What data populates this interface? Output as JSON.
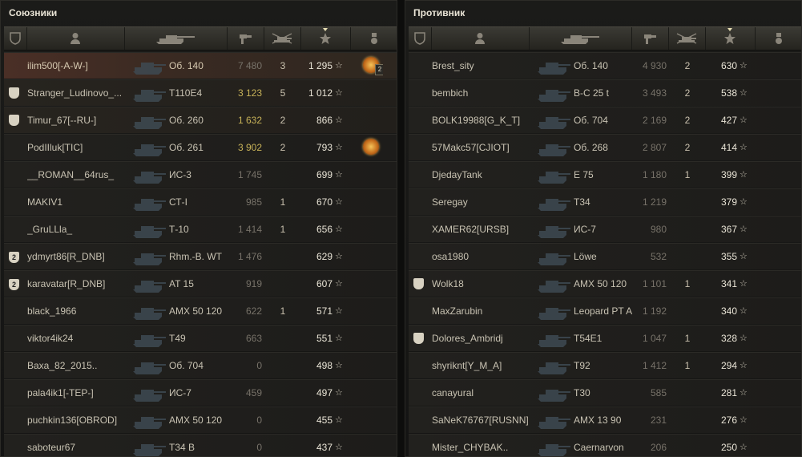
{
  "allies": {
    "title": "Союзники",
    "rows": [
      {
        "name": "ilim500[-A-W-]",
        "tank": "Об. 140",
        "damage": "7 480",
        "frags": "3",
        "xp": "1 295",
        "badge": "",
        "medal": true,
        "medal_count": "2",
        "highlight": "player"
      },
      {
        "name": "Stranger_Ludinovo_...",
        "tank": "T110E4",
        "damage": "3 123",
        "frags": "5",
        "xp": "1 012",
        "badge": "shield",
        "medal": false,
        "medal_count": "",
        "highlight": "platoon"
      },
      {
        "name": "Timur_67[--RU-]",
        "tank": "Об. 260",
        "damage": "1 632",
        "frags": "2",
        "xp": "866",
        "badge": "shield",
        "medal": false,
        "medal_count": "",
        "highlight": "platoon"
      },
      {
        "name": "PodIIluk[TIC]",
        "tank": "Об. 261",
        "damage": "3 902",
        "frags": "2",
        "xp": "793",
        "badge": "",
        "medal": true,
        "medal_count": "",
        "highlight": ""
      },
      {
        "name": "__ROMAN__64rus_",
        "tank": "ИС-3",
        "damage": "1 745",
        "frags": "",
        "xp": "699",
        "badge": "",
        "medal": false,
        "medal_count": "",
        "highlight": ""
      },
      {
        "name": "MAKIV1",
        "tank": "СТ-I",
        "damage": "985",
        "frags": "1",
        "xp": "670",
        "badge": "",
        "medal": false,
        "medal_count": "",
        "highlight": ""
      },
      {
        "name": "_GruLLla_",
        "tank": "Т-10",
        "damage": "1 414",
        "frags": "1",
        "xp": "656",
        "badge": "",
        "medal": false,
        "medal_count": "",
        "highlight": ""
      },
      {
        "name": "ydmyrt86[R_DNB]",
        "tank": "Rhm.-B. WT",
        "damage": "1 476",
        "frags": "",
        "xp": "629",
        "badge": "2",
        "medal": false,
        "medal_count": "",
        "highlight": ""
      },
      {
        "name": "karavatar[R_DNB]",
        "tank": "AT 15",
        "damage": "919",
        "frags": "",
        "xp": "607",
        "badge": "2",
        "medal": false,
        "medal_count": "",
        "highlight": ""
      },
      {
        "name": "black_1966",
        "tank": "AMX 50 120",
        "damage": "622",
        "frags": "1",
        "xp": "571",
        "badge": "",
        "medal": false,
        "medal_count": "",
        "highlight": ""
      },
      {
        "name": "viktor4ik24",
        "tank": "T49",
        "damage": "663",
        "frags": "",
        "xp": "551",
        "badge": "",
        "medal": false,
        "medal_count": "",
        "highlight": ""
      },
      {
        "name": "Baxa_82_2015..",
        "tank": "Об. 704",
        "damage": "0",
        "frags": "",
        "xp": "498",
        "badge": "",
        "medal": false,
        "medal_count": "",
        "highlight": ""
      },
      {
        "name": "pala4ik1[-TEP-]",
        "tank": "ИС-7",
        "damage": "459",
        "frags": "",
        "xp": "497",
        "badge": "",
        "medal": false,
        "medal_count": "",
        "highlight": ""
      },
      {
        "name": "puchkin136[OBROD]",
        "tank": "AMX 50 120",
        "damage": "0",
        "frags": "",
        "xp": "455",
        "badge": "",
        "medal": false,
        "medal_count": "",
        "highlight": ""
      },
      {
        "name": "saboteur67",
        "tank": "T34 B",
        "damage": "0",
        "frags": "",
        "xp": "437",
        "badge": "",
        "medal": false,
        "medal_count": "",
        "highlight": ""
      }
    ]
  },
  "enemies": {
    "title": "Противник",
    "rows": [
      {
        "name": "Brest_sity",
        "tank": "Об. 140",
        "damage": "4 930",
        "frags": "2",
        "xp": "630",
        "badge": "",
        "medal": false,
        "medal_count": "",
        "highlight": ""
      },
      {
        "name": "bembich",
        "tank": "B-C 25 t",
        "damage": "3 493",
        "frags": "2",
        "xp": "538",
        "badge": "",
        "medal": false,
        "medal_count": "",
        "highlight": ""
      },
      {
        "name": "BOLK19988[G_K_T]",
        "tank": "Об. 704",
        "damage": "2 169",
        "frags": "2",
        "xp": "427",
        "badge": "",
        "medal": false,
        "medal_count": "",
        "highlight": ""
      },
      {
        "name": "57Makc57[CJIOT]",
        "tank": "Об. 268",
        "damage": "2 807",
        "frags": "2",
        "xp": "414",
        "badge": "",
        "medal": false,
        "medal_count": "",
        "highlight": ""
      },
      {
        "name": "DjedayTank",
        "tank": "E 75",
        "damage": "1 180",
        "frags": "1",
        "xp": "399",
        "badge": "",
        "medal": false,
        "medal_count": "",
        "highlight": ""
      },
      {
        "name": "Seregay",
        "tank": "T34",
        "damage": "1 219",
        "frags": "",
        "xp": "379",
        "badge": "",
        "medal": false,
        "medal_count": "",
        "highlight": ""
      },
      {
        "name": "XAMER62[URSB]",
        "tank": "ИС-7",
        "damage": "980",
        "frags": "",
        "xp": "367",
        "badge": "",
        "medal": false,
        "medal_count": "",
        "highlight": ""
      },
      {
        "name": "osa1980",
        "tank": "Löwe",
        "damage": "532",
        "frags": "",
        "xp": "355",
        "badge": "",
        "medal": false,
        "medal_count": "",
        "highlight": ""
      },
      {
        "name": "Wolk18",
        "tank": "AMX 50 120",
        "damage": "1 101",
        "frags": "1",
        "xp": "341",
        "badge": "shield",
        "medal": false,
        "medal_count": "",
        "highlight": ""
      },
      {
        "name": "MaxZarubin",
        "tank": "Leopard PT A",
        "damage": "1 192",
        "frags": "",
        "xp": "340",
        "badge": "",
        "medal": false,
        "medal_count": "",
        "highlight": ""
      },
      {
        "name": "Dolores_Ambridj",
        "tank": "T54E1",
        "damage": "1 047",
        "frags": "1",
        "xp": "328",
        "badge": "shield",
        "medal": false,
        "medal_count": "",
        "highlight": ""
      },
      {
        "name": "shyriknt[Y_M_A]",
        "tank": "T92",
        "damage": "1 412",
        "frags": "1",
        "xp": "294",
        "badge": "",
        "medal": false,
        "medal_count": "",
        "highlight": ""
      },
      {
        "name": "canayural",
        "tank": "T30",
        "damage": "585",
        "frags": "",
        "xp": "281",
        "badge": "",
        "medal": false,
        "medal_count": "",
        "highlight": ""
      },
      {
        "name": "SaNeK76767[RUSNN]",
        "tank": "AMX 13 90",
        "damage": "231",
        "frags": "",
        "xp": "276",
        "badge": "",
        "medal": false,
        "medal_count": "",
        "highlight": ""
      },
      {
        "name": "Mister_CHYBAK..",
        "tank": "Caernarvon",
        "damage": "206",
        "frags": "",
        "xp": "250",
        "badge": "",
        "medal": false,
        "medal_count": "",
        "highlight": ""
      }
    ]
  },
  "icons": {
    "squad": "squad-shield-icon",
    "player": "player-icon",
    "tank": "tank-icon",
    "damage": "damage-icon",
    "frags": "frags-icon",
    "xp": "xp-star-icon",
    "medal": "medal-icon"
  },
  "colors": {
    "player_row": "#4a2f26",
    "damage_high": "#c7b258",
    "text": "#c8c2b2"
  }
}
